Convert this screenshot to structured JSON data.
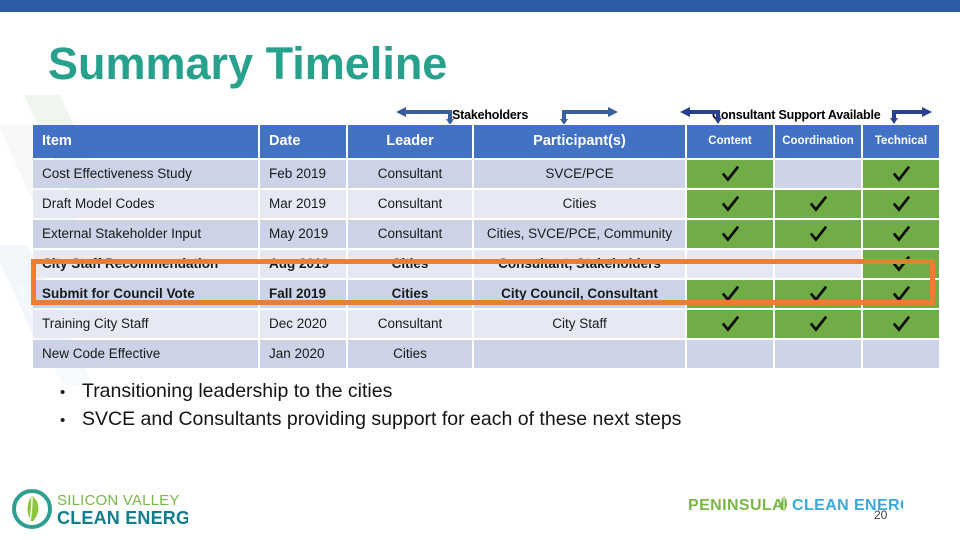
{
  "slide": {
    "title": "Summary Timeline",
    "page_number": "20",
    "accent_title_color": "#27a18b",
    "top_bar_color": "#2e5ba6",
    "header_fill_color": "#4371c4",
    "highlight_box_color": "#ed7d31",
    "check_cell_color": "#70ad47"
  },
  "span_labels": {
    "stakeholders": "Stakeholders",
    "consultant_support": "Consultant Support Available"
  },
  "table": {
    "columns": [
      {
        "label": "Item",
        "align": "left"
      },
      {
        "label": "Date",
        "align": "left"
      },
      {
        "label": "Leader",
        "align": "center"
      },
      {
        "label": "Participant(s)",
        "align": "center"
      },
      {
        "label": "Content",
        "align": "center"
      },
      {
        "label": "Coordination",
        "align": "center"
      },
      {
        "label": "Technical",
        "align": "center"
      }
    ],
    "rows": [
      {
        "item": "Cost Effectiveness Study",
        "date": "Feb 2019",
        "leader": "Consultant",
        "participants": "SVCE/PCE",
        "content": true,
        "coordination": false,
        "technical": true,
        "bold": false
      },
      {
        "item": "Draft Model Codes",
        "date": "Mar 2019",
        "leader": "Consultant",
        "participants": "Cities",
        "content": true,
        "coordination": true,
        "technical": true,
        "bold": false
      },
      {
        "item": "External Stakeholder Input",
        "date": "May 2019",
        "leader": "Consultant",
        "participants": "Cities, SVCE/PCE, Community",
        "content": true,
        "coordination": true,
        "technical": true,
        "bold": false
      },
      {
        "item": "City Staff Recommendation",
        "date": "Aug 2019",
        "leader": "Cities",
        "participants": "Consultant, Stakeholders",
        "content": false,
        "coordination": false,
        "technical": true,
        "bold": true
      },
      {
        "item": "Submit for Council Vote",
        "date": "Fall 2019",
        "leader": "Cities",
        "participants": "City Council, Consultant",
        "content": true,
        "coordination": true,
        "technical": true,
        "bold": true
      },
      {
        "item": "Training City Staff",
        "date": "Dec 2020",
        "leader": "Consultant",
        "participants": "City Staff",
        "content": true,
        "coordination": true,
        "technical": true,
        "bold": false
      },
      {
        "item": "New Code Effective",
        "date": "Jan 2020",
        "leader": "Cities",
        "participants": "",
        "content": false,
        "coordination": false,
        "technical": false,
        "bold": false
      }
    ],
    "highlighted_rows": [
      3,
      4
    ]
  },
  "bullets": [
    "Transitioning leadership to the cities",
    "SVCE and Consultants providing support for each of these next steps"
  ],
  "logos": {
    "svce_line1": "SILICON VALLEY",
    "svce_line2": "CLEAN ENERGY",
    "pce_line1": "PENINSULA",
    "pce_line2": "CLEAN ENERGY"
  }
}
